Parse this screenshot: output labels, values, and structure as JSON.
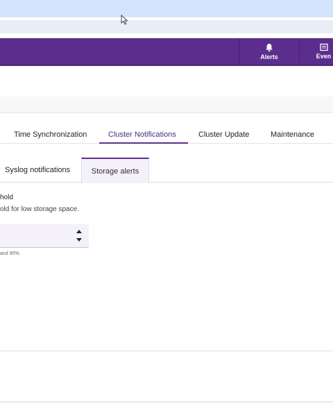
{
  "topbar": {
    "alerts_label": "Alerts",
    "events_label": "Even"
  },
  "main_tabs": [
    {
      "label": "Time Synchronization",
      "active": false
    },
    {
      "label": "Cluster Notifications",
      "active": true
    },
    {
      "label": "Cluster Update",
      "active": false
    },
    {
      "label": "Maintenance",
      "active": false
    }
  ],
  "sub_tabs": [
    {
      "label": "Syslog notifications",
      "active": false
    },
    {
      "label": "Storage alerts",
      "active": true
    }
  ],
  "storage_alerts": {
    "field_label": "hold",
    "field_description": "old for low storage space.",
    "input_value": "",
    "hint": "and 90%."
  },
  "colors": {
    "brand": "#5b2e8e",
    "active_tab_text": "#4d2a7f",
    "browser_tabstrip": "#d3e3fd"
  },
  "icons": [
    "bell-icon",
    "events-icon",
    "mouse-cursor-icon",
    "caret-up-icon",
    "caret-down-icon"
  ]
}
